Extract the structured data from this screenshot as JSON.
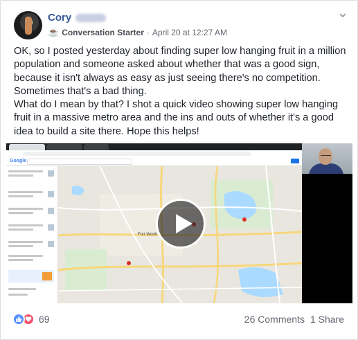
{
  "post": {
    "author_name": "Cory",
    "group_badge": "Conversation Starter",
    "separator": "·",
    "timestamp": "April 20 at 12:27 AM",
    "paragraphs": [
      "OK, so I posted yesterday about finding super low hanging fruit in a million population and someone asked about whether that was a good sign, because it isn't always as easy as just seeing there's no competition. Sometimes that's a bad thing.",
      "What do I mean by that? I shot a quick video showing super low hanging fruit in a massive metro area and the ins and outs of whether it's a good idea to build a site there. Hope this helps!"
    ]
  },
  "video": {
    "browser_logo": "Google",
    "map_city_label": "Fort Worth",
    "play_icon": "play-icon"
  },
  "footer": {
    "reactions": [
      "like-icon",
      "love-icon"
    ],
    "reaction_count": "69",
    "comments": "26 Comments",
    "shares": "1 Share"
  },
  "colors": {
    "link_blue": "#365899",
    "like_blue": "#5890ff",
    "love_red": "#f25268",
    "meta_gray": "#616770"
  }
}
